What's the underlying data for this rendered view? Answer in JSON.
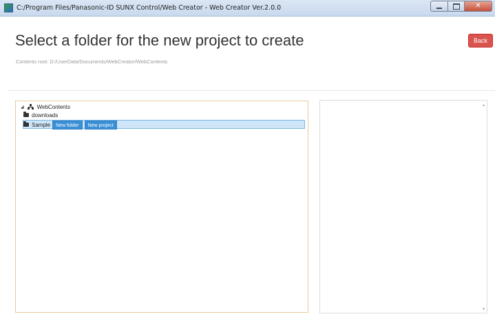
{
  "window": {
    "title": "C:/Program Files/Panasonic-ID SUNX Control/Web Creator - Web Creator Ver.2.0.0"
  },
  "header": {
    "title": "Select a folder for the new project to create",
    "back_label": "Back",
    "contents_root": "Contents root: D:/UserData/Documents/WebCreator/WebContents"
  },
  "tree": {
    "root": {
      "label": "WebContents",
      "icon": "sitemap-icon",
      "expanded": true
    },
    "items": [
      {
        "label": "downloads",
        "icon": "folder-icon"
      },
      {
        "label": "Sample",
        "icon": "folder-icon",
        "selected": true
      }
    ],
    "actions": {
      "new_folder": "New folder",
      "new_project": "New project"
    }
  },
  "colors": {
    "back_button": "#d9534f",
    "selection": "#cfe6f9",
    "action_button": "#3a8fd6",
    "tree_border": "#e7c99a"
  }
}
